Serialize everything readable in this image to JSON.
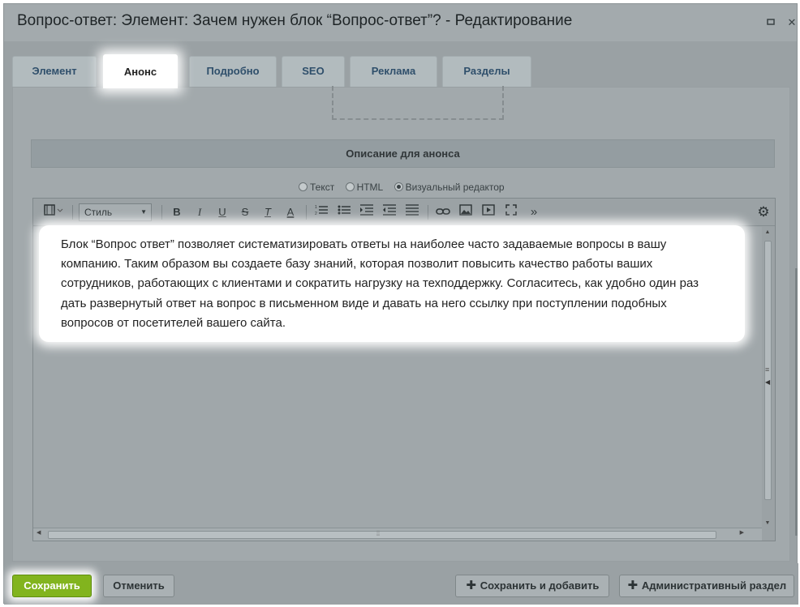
{
  "window": {
    "title": "Вопрос-ответ: Элемент: Зачем нужен блок “Вопрос-ответ”? - Редактирование",
    "maximize_icon": "maximize-icon",
    "close_icon": "close-icon"
  },
  "tabs": [
    {
      "label": "Элемент",
      "active": false
    },
    {
      "label": "Анонс",
      "active": true
    },
    {
      "label": "Подробно",
      "active": false
    },
    {
      "label": "SEO",
      "active": false
    },
    {
      "label": "Реклама",
      "active": false
    },
    {
      "label": "Разделы",
      "active": false
    }
  ],
  "section": {
    "heading": "Описание для анонса"
  },
  "modes": {
    "text": "Текст",
    "html": "HTML",
    "visual": "Визуальный редактор",
    "selected": "visual"
  },
  "toolbar": {
    "style_label": "Стиль",
    "bold": "B",
    "italic": "I",
    "underline": "U",
    "strike": "S",
    "clear_format": "T",
    "color": "A",
    "more": "»"
  },
  "editor": {
    "content": "Блок “Вопрос ответ” позволяет систематизировать ответы на наиболее часто задаваемые вопросы в вашу\nкомпанию. Таким образом вы создаете базу знаний, которая позволит повысить качество работы ваших\nсотрудников, работающих с клиентами и сократить нагрузку на техподдержку. Согласитесь, как удобно один раз\nдать развернутый ответ на вопрос в письменном виде и давать на него ссылку при поступлении подобных\nвопросов от посетителей вашего сайта."
  },
  "footer": {
    "save": "Сохранить",
    "cancel": "Отменить",
    "save_and_add": "Сохранить и добавить",
    "admin_section": "Административный раздел"
  },
  "colors": {
    "save_button": "#82b41e",
    "tab_text": "#2f4f6b",
    "overlay": "#9aa1a4"
  }
}
